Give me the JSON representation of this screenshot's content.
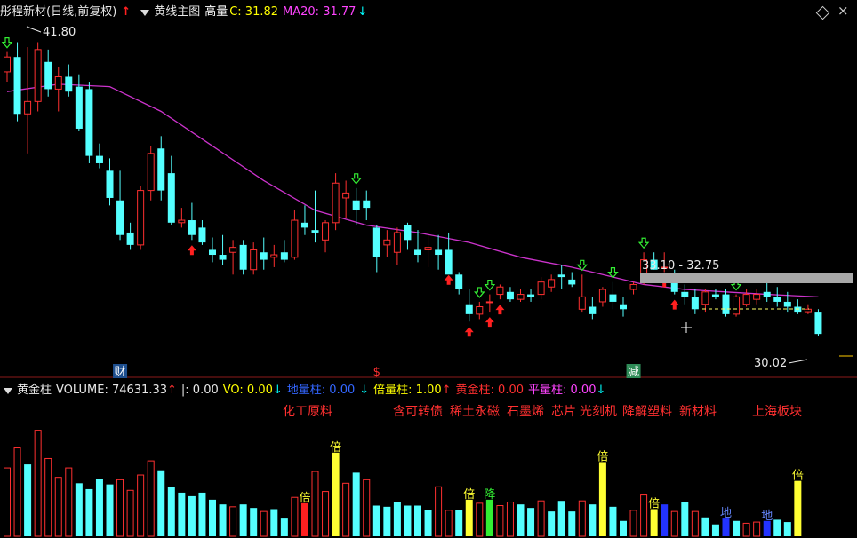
{
  "header": {
    "stock_name": "彤程新材(日线,前复权)",
    "indicator_name": "黄线主图",
    "gaoliang_label": "高量",
    "close_label": "C: 31.82",
    "ma_label": "MA20: 31.77",
    "ma_arrow": "↓"
  },
  "sub_header": {
    "title": "黄金柱",
    "volume": "VOLUME: 74631.33",
    "volume_arrow": "↑",
    "i_label": "|: 0.00",
    "vo_label": "VO: 0.00",
    "vo_arrow": "↓",
    "diliang": "地量柱: 0.00",
    "diliang_arrow": "↓",
    "beiliang": "倍量柱: 1.00",
    "beiliang_arrow": "↑",
    "huangjin": "黄金柱: 0.00",
    "pingliang": "平量柱: 0.00",
    "pingliang_arrow": "↓"
  },
  "keywords": [
    "化工原料",
    "含可转债",
    "稀土永磁",
    "石墨烯",
    "芯片",
    "光刻机",
    "降解塑料",
    "新材料",
    "上海板块"
  ],
  "colors": {
    "up": "#ff3030",
    "down": "#54ffff",
    "ma": "#cc33cc",
    "gold": "#ffff33",
    "diliang": "#2233ff",
    "green": "#33ee33"
  },
  "chart_data": {
    "type": "candlestick",
    "y_price_range": [
      29.0,
      42.5
    ],
    "high_label": "41.80",
    "low_label": "30.02",
    "range_label": "33.10 - 32.75",
    "event_marks": [
      {
        "i": 11,
        "label": "财"
      },
      {
        "i": 36,
        "label": "$"
      },
      {
        "i": 61,
        "label": "减"
      }
    ],
    "candles": [
      [
        40.6,
        41.4,
        40.2,
        41.2
      ],
      [
        41.2,
        41.8,
        38.6,
        38.9
      ],
      [
        38.9,
        41.6,
        37.3,
        39.4
      ],
      [
        39.4,
        41.8,
        39.0,
        41.5
      ],
      [
        41.0,
        41.5,
        39.6,
        39.9
      ],
      [
        39.9,
        40.8,
        39.0,
        40.4
      ],
      [
        40.4,
        40.9,
        39.6,
        39.8
      ],
      [
        40.0,
        40.5,
        38.2,
        38.3
      ],
      [
        39.9,
        40.2,
        36.9,
        37.2
      ],
      [
        37.2,
        37.7,
        36.7,
        36.9
      ],
      [
        36.6,
        37.1,
        35.2,
        35.5
      ],
      [
        35.4,
        36.6,
        33.8,
        34.0
      ],
      [
        34.1,
        34.5,
        33.4,
        33.6
      ],
      [
        33.6,
        36.0,
        33.4,
        35.8
      ],
      [
        35.8,
        37.6,
        35.4,
        37.3
      ],
      [
        37.5,
        38.0,
        35.4,
        35.8
      ],
      [
        36.5,
        37.2,
        34.4,
        34.5
      ],
      [
        34.5,
        35.1,
        34.3,
        34.6
      ],
      [
        34.6,
        35.3,
        33.8,
        34.0
      ],
      [
        34.3,
        34.6,
        33.6,
        33.7
      ],
      [
        33.4,
        33.9,
        32.9,
        33.2
      ],
      [
        33.2,
        34.0,
        32.8,
        33.0
      ],
      [
        33.3,
        33.8,
        32.4,
        33.5
      ],
      [
        33.6,
        33.8,
        32.4,
        32.6
      ],
      [
        32.6,
        33.7,
        32.4,
        33.4
      ],
      [
        33.3,
        33.9,
        32.6,
        33.0
      ],
      [
        33.1,
        33.6,
        32.7,
        33.2
      ],
      [
        33.3,
        33.8,
        32.9,
        33.0
      ],
      [
        33.1,
        35.0,
        33.0,
        34.6
      ],
      [
        34.5,
        35.2,
        34.0,
        34.3
      ],
      [
        34.2,
        35.8,
        33.7,
        34.1
      ],
      [
        33.8,
        34.6,
        33.3,
        34.5
      ],
      [
        34.5,
        36.5,
        34.2,
        36.1
      ],
      [
        35.5,
        36.2,
        34.7,
        35.7
      ],
      [
        35.4,
        35.9,
        34.4,
        35.0
      ],
      [
        35.4,
        35.8,
        34.6,
        35.1
      ],
      [
        34.3,
        34.4,
        32.5,
        33.1
      ],
      [
        33.6,
        34.2,
        33.1,
        33.8
      ],
      [
        33.3,
        34.3,
        32.8,
        34.1
      ],
      [
        34.4,
        34.5,
        33.4,
        33.8
      ],
      [
        33.4,
        34.2,
        32.9,
        33.2
      ],
      [
        33.4,
        34.1,
        32.7,
        33.5
      ],
      [
        33.4,
        34.0,
        32.6,
        33.2
      ],
      [
        33.4,
        34.1,
        32.6,
        32.4
      ],
      [
        32.4,
        32.5,
        31.6,
        31.8
      ],
      [
        31.2,
        31.8,
        30.5,
        30.8
      ],
      [
        30.8,
        31.3,
        30.6,
        31.1
      ],
      [
        31.3,
        31.6,
        30.9,
        31.3
      ],
      [
        31.6,
        32.0,
        31.4,
        31.9
      ],
      [
        31.7,
        31.9,
        31.3,
        31.4
      ],
      [
        31.4,
        31.8,
        31.3,
        31.6
      ],
      [
        31.6,
        31.8,
        31.3,
        31.5
      ],
      [
        31.6,
        32.3,
        31.4,
        32.1
      ],
      [
        31.9,
        32.4,
        31.7,
        32.2
      ],
      [
        32.4,
        32.8,
        31.8,
        32.3
      ],
      [
        32.2,
        32.5,
        31.9,
        32.0
      ],
      [
        31.0,
        32.4,
        30.9,
        31.5
      ],
      [
        31.1,
        31.5,
        30.6,
        30.8
      ],
      [
        31.3,
        31.9,
        31.1,
        31.8
      ],
      [
        31.6,
        32.1,
        31.0,
        31.3
      ],
      [
        31.2,
        31.5,
        30.7,
        31.0
      ],
      [
        31.8,
        32.1,
        31.6,
        32.0
      ],
      [
        32.2,
        33.3,
        32.0,
        33.0
      ],
      [
        33.0,
        33.3,
        32.6,
        32.6
      ],
      [
        32.7,
        33.3,
        32.5,
        32.7
      ],
      [
        32.4,
        32.6,
        31.6,
        31.7
      ],
      [
        31.7,
        32.0,
        31.2,
        31.5
      ],
      [
        31.5,
        31.8,
        30.8,
        31.0
      ],
      [
        31.2,
        31.8,
        30.9,
        31.7
      ],
      [
        31.6,
        31.8,
        31.4,
        31.5
      ],
      [
        31.6,
        31.8,
        30.7,
        30.8
      ],
      [
        30.8,
        31.6,
        30.7,
        31.5
      ],
      [
        31.2,
        31.8,
        31.1,
        31.6
      ],
      [
        31.4,
        31.8,
        31.2,
        31.6
      ],
      [
        31.7,
        32.1,
        31.3,
        31.5
      ],
      [
        31.5,
        31.9,
        31.1,
        31.3
      ],
      [
        31.3,
        31.7,
        30.9,
        31.1
      ],
      [
        31.1,
        31.4,
        30.8,
        30.9
      ],
      [
        30.9,
        31.2,
        30.8,
        31.0
      ],
      [
        30.9,
        31.0,
        29.9,
        30.0
      ]
    ],
    "ma20": [
      [
        0,
        39.8
      ],
      [
        5,
        40.1
      ],
      [
        10,
        40.0
      ],
      [
        15,
        39.0
      ],
      [
        20,
        37.6
      ],
      [
        25,
        36.2
      ],
      [
        30,
        35.0
      ],
      [
        35,
        34.4
      ],
      [
        40,
        34.1
      ],
      [
        45,
        33.7
      ],
      [
        50,
        33.1
      ],
      [
        55,
        32.7
      ],
      [
        58,
        32.4
      ],
      [
        62,
        32.0
      ],
      [
        66,
        31.8
      ],
      [
        70,
        31.7
      ],
      [
        74,
        31.6
      ],
      [
        79,
        31.5
      ]
    ],
    "signal_up": [
      18,
      43,
      45,
      47,
      48,
      64,
      65
    ],
    "signal_down": [
      0,
      34,
      46,
      47,
      56,
      59,
      62,
      71
    ],
    "volumes": [
      [
        5800,
        "up"
      ],
      [
        7500,
        "up"
      ],
      [
        6100,
        "down"
      ],
      [
        9000,
        "up"
      ],
      [
        6600,
        "up"
      ],
      [
        5000,
        "up"
      ],
      [
        5800,
        "up"
      ],
      [
        4500,
        "down"
      ],
      [
        4000,
        "down"
      ],
      [
        4900,
        "down"
      ],
      [
        4400,
        "down"
      ],
      [
        4800,
        "up"
      ],
      [
        3900,
        "up"
      ],
      [
        5200,
        "up"
      ],
      [
        6400,
        "up"
      ],
      [
        5600,
        "down"
      ],
      [
        4200,
        "down"
      ],
      [
        3700,
        "down"
      ],
      [
        3400,
        "down"
      ],
      [
        3700,
        "down"
      ],
      [
        3100,
        "down"
      ],
      [
        2700,
        "down"
      ],
      [
        2500,
        "up"
      ],
      [
        2700,
        "down"
      ],
      [
        2400,
        "down"
      ],
      [
        2100,
        "up"
      ],
      [
        2300,
        "down"
      ],
      [
        1500,
        "down"
      ],
      [
        3300,
        "up"
      ],
      [
        2800,
        "up"
      ],
      [
        5500,
        "up"
      ],
      [
        3800,
        "up"
      ],
      [
        7100,
        "up"
      ],
      [
        4500,
        "up"
      ],
      [
        5400,
        "down"
      ],
      [
        4800,
        "up"
      ],
      [
        2600,
        "down"
      ],
      [
        2500,
        "down"
      ],
      [
        2900,
        "down"
      ],
      [
        2600,
        "down"
      ],
      [
        2600,
        "down"
      ],
      [
        2200,
        "down"
      ],
      [
        4200,
        "up"
      ],
      [
        2200,
        "up"
      ],
      [
        2200,
        "down"
      ],
      [
        3100,
        "up"
      ],
      [
        2800,
        "up"
      ],
      [
        3100,
        "up"
      ],
      [
        2600,
        "up"
      ],
      [
        2900,
        "up"
      ],
      [
        2700,
        "down"
      ],
      [
        2400,
        "down"
      ],
      [
        3000,
        "up"
      ],
      [
        2100,
        "down"
      ],
      [
        3000,
        "down"
      ],
      [
        2100,
        "down"
      ],
      [
        3000,
        "up"
      ],
      [
        2700,
        "down"
      ],
      [
        6300,
        "up"
      ],
      [
        2500,
        "down"
      ],
      [
        1300,
        "down"
      ],
      [
        2200,
        "up"
      ],
      [
        3500,
        "up"
      ],
      [
        2300,
        "down"
      ],
      [
        2700,
        "down"
      ],
      [
        2100,
        "up"
      ],
      [
        2900,
        "down"
      ],
      [
        2100,
        "up"
      ],
      [
        1600,
        "down"
      ],
      [
        1000,
        "down"
      ],
      [
        1500,
        "down"
      ],
      [
        1300,
        "down"
      ],
      [
        1100,
        "up"
      ],
      [
        1200,
        "up"
      ],
      [
        1300,
        "down"
      ],
      [
        1400,
        "down"
      ],
      [
        1200,
        "down"
      ],
      [
        4700,
        "down"
      ]
    ],
    "vol_special": [
      {
        "i": 29,
        "kind": "red",
        "label": "倍"
      },
      {
        "i": 32,
        "kind": "gold",
        "label": "倍"
      },
      {
        "i": 45,
        "kind": "gold",
        "label": "倍"
      },
      {
        "i": 47,
        "kind": "green",
        "label": "降"
      },
      {
        "i": 58,
        "kind": "gold",
        "label": "倍"
      },
      {
        "i": 63,
        "kind": "gold",
        "label": "倍"
      },
      {
        "i": 64,
        "kind": "diliang",
        "label": ""
      },
      {
        "i": 70,
        "kind": "diliang",
        "label": "地"
      },
      {
        "i": 74,
        "kind": "diliang",
        "label": "地"
      },
      {
        "i": 77,
        "kind": "gold",
        "label": "倍"
      }
    ],
    "vol_max": 9500
  }
}
